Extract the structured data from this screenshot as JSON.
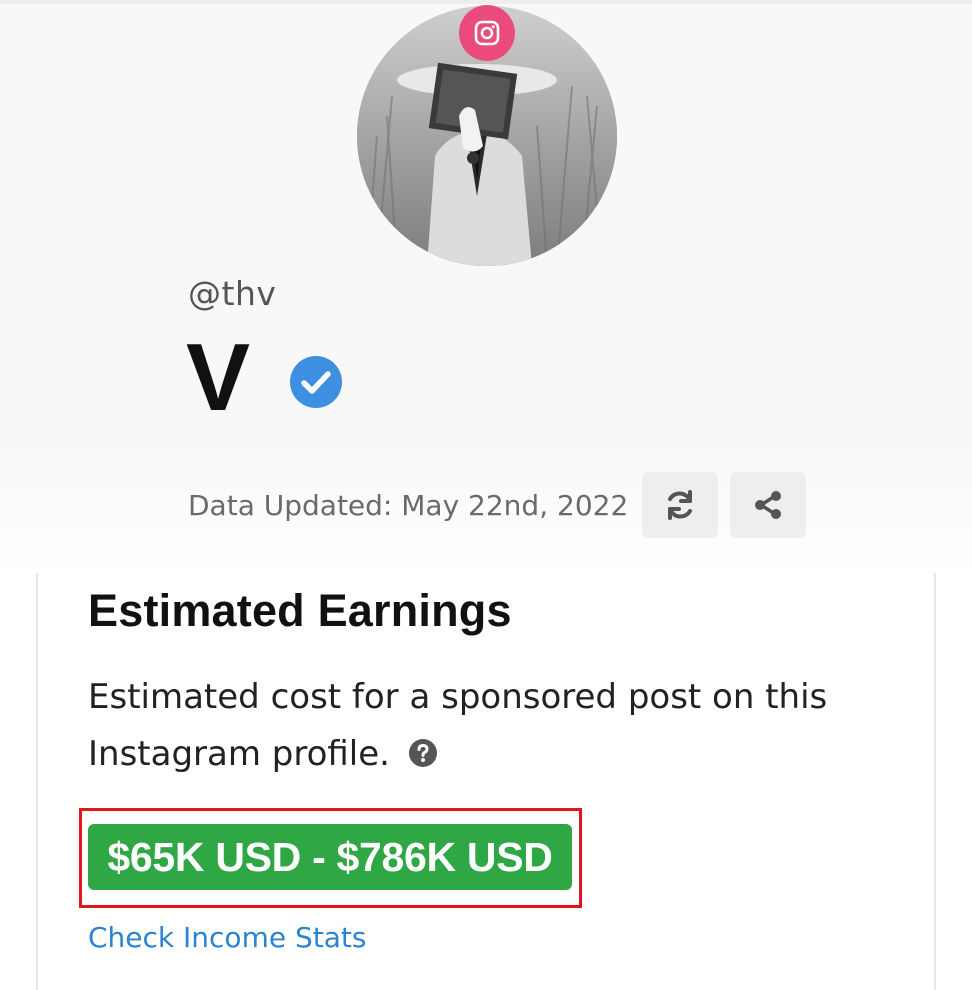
{
  "profile": {
    "platform_icon": "instagram-icon",
    "avatar_alt": "profile photo",
    "handle": "@thv",
    "display_name": "V",
    "verified_icon": "verified-check-icon",
    "updated_text": "Data Updated: May 22nd, 2022",
    "refresh_icon": "refresh-icon",
    "share_icon": "share-icon"
  },
  "earnings": {
    "title": "Estimated Earnings",
    "description": "Estimated cost for a sponsored post on this Instagram profile.",
    "help_icon": "question-circle-icon",
    "range": "$65K USD - $786K USD",
    "link": "Check Income Stats"
  },
  "colors": {
    "instagram_pink": "#ea4b7b",
    "verified_blue": "#3d8fe0",
    "earnings_green": "#2ea744",
    "highlight_red": "#e0151d",
    "link_blue": "#2b84d0"
  }
}
